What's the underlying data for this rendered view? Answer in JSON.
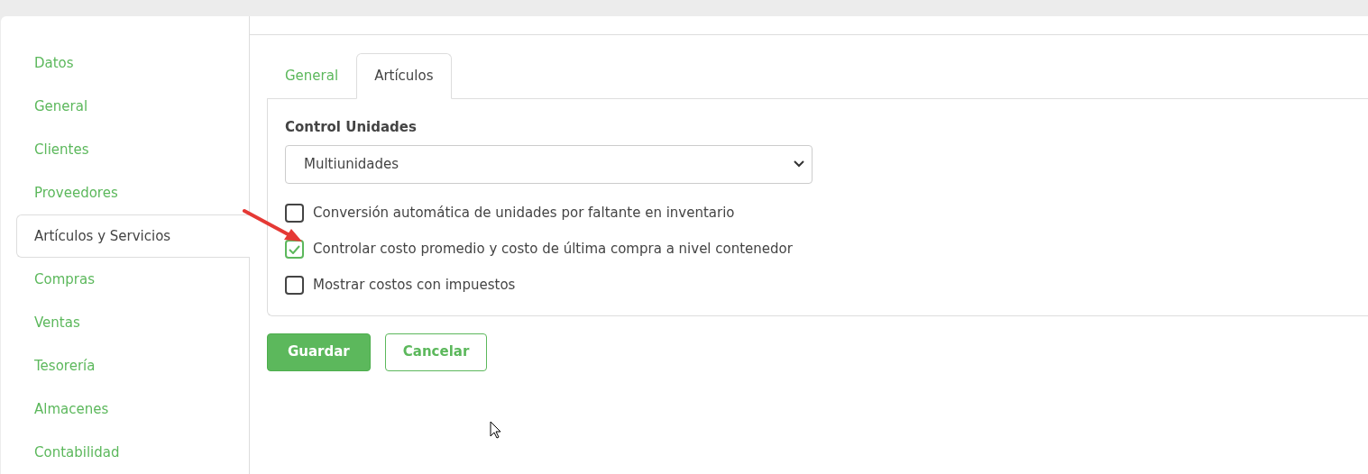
{
  "sidebar": {
    "items": [
      {
        "label": "Datos",
        "selected": false
      },
      {
        "label": "General",
        "selected": false
      },
      {
        "label": "Clientes",
        "selected": false
      },
      {
        "label": "Proveedores",
        "selected": false
      },
      {
        "label": "Artículos y Servicios",
        "selected": true
      },
      {
        "label": "Compras",
        "selected": false
      },
      {
        "label": "Ventas",
        "selected": false
      },
      {
        "label": "Tesorería",
        "selected": false
      },
      {
        "label": "Almacenes",
        "selected": false
      },
      {
        "label": "Contabilidad",
        "selected": false
      }
    ]
  },
  "tabs": [
    {
      "label": "General",
      "selected": false
    },
    {
      "label": "Artículos",
      "selected": true
    }
  ],
  "form": {
    "field_label": "Control Unidades",
    "select": {
      "value": "Multiunidades"
    },
    "options": [
      {
        "label": "Conversión automática de unidades por faltante en inventario",
        "checked": false
      },
      {
        "label": "Controlar costo promedio y costo de última compra a nivel contenedor",
        "checked": true
      },
      {
        "label": "Mostrar costos con impuestos",
        "checked": false
      }
    ]
  },
  "buttons": [
    {
      "label": "Guardar",
      "kind": "primary"
    },
    {
      "label": "Cancelar",
      "kind": "secondary"
    }
  ]
}
